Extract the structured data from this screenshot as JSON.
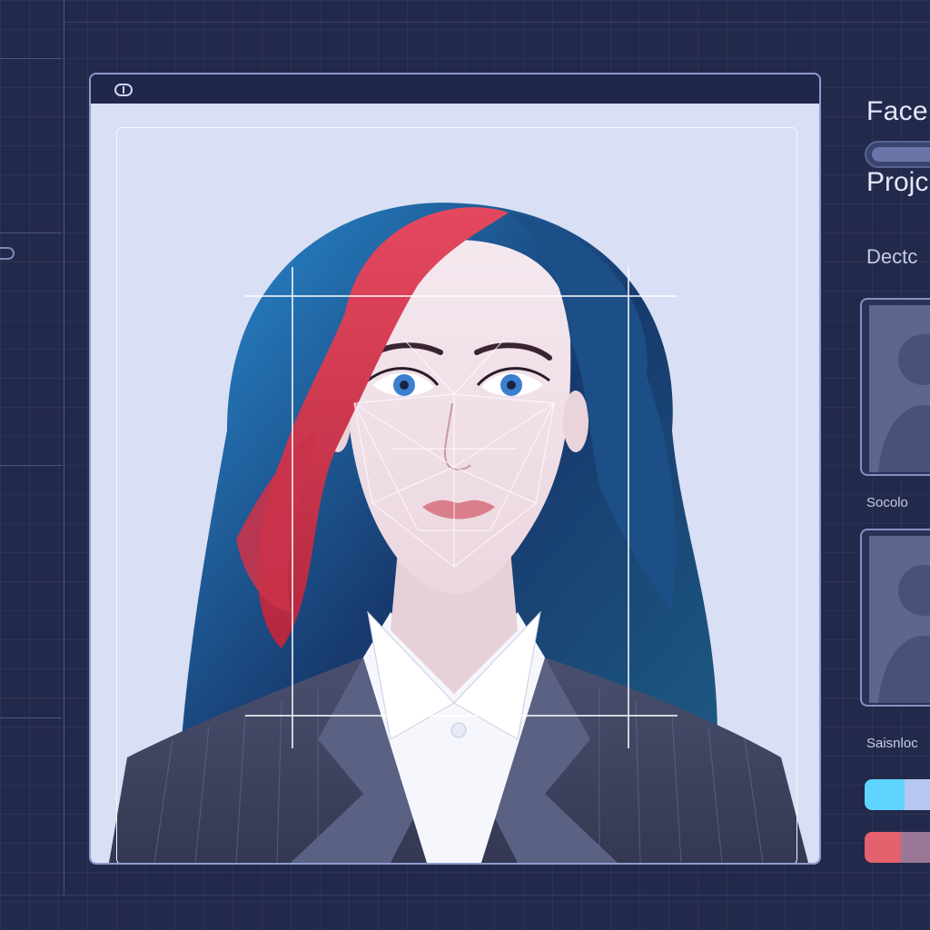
{
  "viewer": {
    "title_icon": "toggle-icon",
    "detection": {
      "mesh_color": "#ffffff",
      "box_color": "#ffffff"
    }
  },
  "right_panel": {
    "title": "Face",
    "subtitle": "Projc",
    "section_label": "Dectc",
    "thumbnails": [
      {
        "caption": "Socolo",
        "icon": "person-silhouette-icon"
      },
      {
        "caption": "Saisnloc",
        "icon": "person-silhouette-icon"
      }
    ],
    "color_bars": [
      {
        "name": "cyan-bar",
        "colors": [
          "#5fd4ff",
          "#b7c8f0"
        ]
      },
      {
        "name": "red-bar",
        "colors": [
          "#e4616d",
          "#9a7895"
        ]
      }
    ]
  },
  "colors": {
    "background": "#23294a",
    "frame_border": "#8e9ad0",
    "canvas": "#d9dff4"
  }
}
